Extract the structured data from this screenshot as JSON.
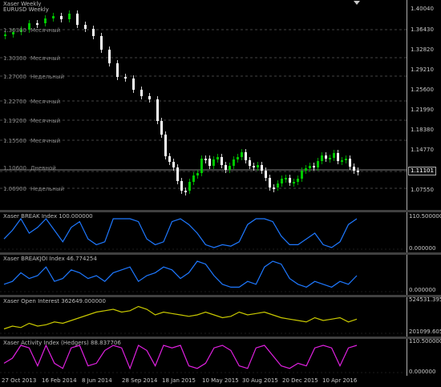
{
  "window": {
    "title_line1": "Xaser Weekly",
    "title_line2": "EURUSD Weekly"
  },
  "main_chart": {
    "price_labels": [
      "1.40040",
      "1.36430",
      "1.32820",
      "1.29210",
      "1.25600",
      "1.21990",
      "1.18380",
      "1.14770",
      "1.11101",
      "1.07550"
    ],
    "current_price": "1.11101",
    "levels": [
      {
        "price": "1.36300",
        "label": "Месячный"
      },
      {
        "price": "1.30300",
        "label": "Месячный"
      },
      {
        "price": "1.27000",
        "label": "Недельный"
      },
      {
        "price": "1.22700",
        "label": "Месячный"
      },
      {
        "price": "1.19200",
        "label": "Месячный"
      },
      {
        "price": "1.15500",
        "label": "Месячный"
      },
      {
        "price": "1.10600",
        "label": "Дневной"
      },
      {
        "price": "1.06900",
        "label": "Недельный"
      }
    ],
    "colors": {
      "bull": "#00c800",
      "bear": "#ffffff",
      "grid": "#5a5a5a"
    }
  },
  "indicators": [
    {
      "title": "Xaser BREAK Index 100.000000",
      "scale_top": "110.500000",
      "scale_bottom": "0.000000",
      "color": "#1e78ff"
    },
    {
      "title": "Xaser BREAKJOI Index 46.774254",
      "scale_top": "",
      "scale_bottom": "0.000000",
      "color": "#1e78ff"
    },
    {
      "title": "Xaser Open Interest 362649.000000",
      "scale_top": "524531.395",
      "scale_bottom": "201099.605",
      "color": "#c8c800"
    },
    {
      "title": "Xaser Activity Index (Hedgers) 88.837706",
      "scale_top": "110.500000",
      "scale_bottom": "0.000000",
      "color": "#e020e0"
    }
  ],
  "date_axis": [
    "27 Oct 2013",
    "16 Feb 2014",
    "8 Jun 2014",
    "28 Sep 2014",
    "18 Jan 2015",
    "10 May 2015",
    "30 Aug 2015",
    "20 Dec 2015",
    "10 Apr 2016"
  ]
}
